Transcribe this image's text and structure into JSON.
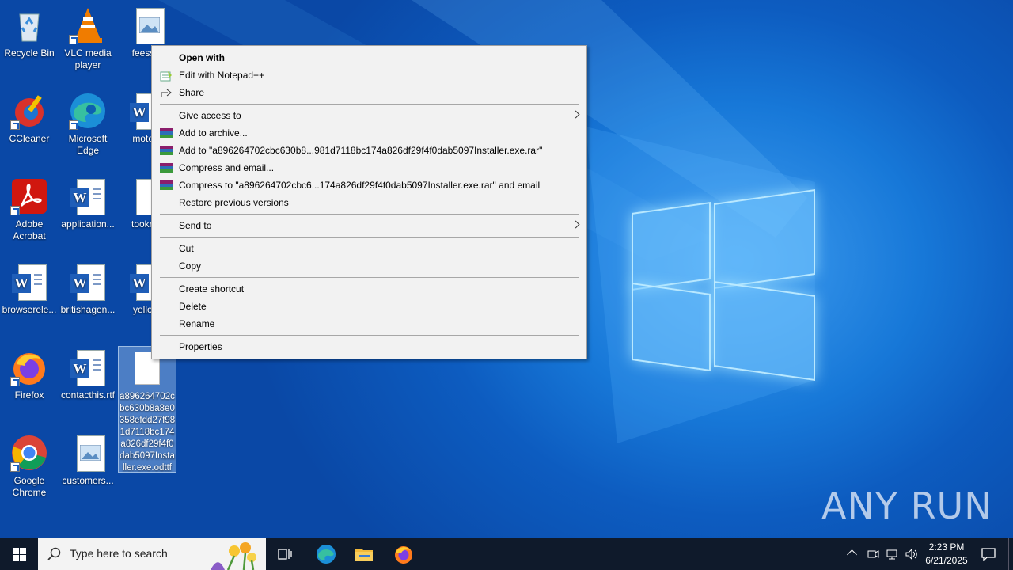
{
  "desktop": {
    "icons": [
      {
        "label": "Recycle Bin",
        "icon": "recycle-bin-icon"
      },
      {
        "label": "VLC media player",
        "icon": "vlc-icon"
      },
      {
        "label": "feessto",
        "icon": "image-file-icon"
      },
      {
        "label": "CCleaner",
        "icon": "ccleaner-icon"
      },
      {
        "label": "Microsoft Edge",
        "icon": "edge-icon"
      },
      {
        "label": "motore",
        "icon": "word-doc-icon"
      },
      {
        "label": "Adobe Acrobat",
        "icon": "acrobat-icon"
      },
      {
        "label": "application...",
        "icon": "word-doc-icon"
      },
      {
        "label": "tookrep",
        "icon": "image-file-icon"
      },
      {
        "label": "browserele...",
        "icon": "word-doc-icon"
      },
      {
        "label": "britishagen...",
        "icon": "word-doc-icon"
      },
      {
        "label": "yellowl",
        "icon": "word-doc-icon"
      },
      {
        "label": "Firefox",
        "icon": "firefox-icon"
      },
      {
        "label": "contacthis.rtf",
        "icon": "word-doc-icon"
      },
      {
        "label": "a896264702cbc630b8a8e0358efdd27f981d7118bc174a826df29f4f0dab5097Installer.exe.odttf",
        "icon": "blank-file-icon"
      },
      {
        "label": "Google Chrome",
        "icon": "chrome-icon"
      },
      {
        "label": "customers...",
        "icon": "image-file-icon"
      }
    ]
  },
  "context_menu": {
    "items": [
      {
        "label": "Open with",
        "bold": true
      },
      {
        "label": "Edit with Notepad++",
        "icon": "notepadpp-icon"
      },
      {
        "label": "Share",
        "icon": "share-icon"
      },
      {
        "label": "Give access to",
        "submenu": true
      },
      {
        "label": "Add to archive...",
        "icon": "winrar-icon"
      },
      {
        "label": "Add to \"a896264702cbc630b8...981d7118bc174a826df29f4f0dab5097Installer.exe.rar\"",
        "icon": "winrar-icon"
      },
      {
        "label": "Compress and email...",
        "icon": "winrar-icon"
      },
      {
        "label": "Compress to \"a896264702cbc6...174a826df29f4f0dab5097Installer.exe.rar\" and email",
        "icon": "winrar-icon"
      },
      {
        "label": "Restore previous versions"
      },
      {
        "label": "Send to",
        "submenu": true
      },
      {
        "label": "Cut"
      },
      {
        "label": "Copy"
      },
      {
        "label": "Create shortcut"
      },
      {
        "label": "Delete"
      },
      {
        "label": "Rename"
      },
      {
        "label": "Properties"
      }
    ]
  },
  "taskbar": {
    "search_placeholder": "Type here to search",
    "time": "2:23 PM",
    "date": "6/21/2025"
  },
  "watermark": "ANY RUN"
}
